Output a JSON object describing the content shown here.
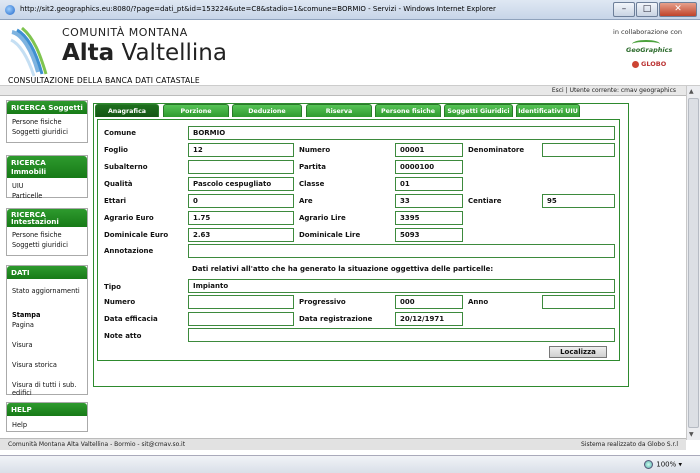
{
  "browser": {
    "title": "http://sit2.geographics.eu:8080/?page=dati_pt&id=153224&ute=C8&stadio=1&comune=BORMIO - Servizi - Windows Internet Explorer",
    "zoom": "100%"
  },
  "header": {
    "org_top": "COMUNITÀ MONTANA",
    "org_main_bold": "Alta",
    "org_main_rest": "Valtellina",
    "subtitle": "CONSULTAZIONE DELLA BANCA DATI CATASTALE",
    "collab": "in collaborazione con",
    "geo_logo": "GeoGraphics",
    "globo_logo": "GLOBO"
  },
  "userbar": {
    "text": "Esci | Utente corrente: cmav geographics"
  },
  "sidebar": {
    "soggetti": {
      "title": "RICERCA Soggetti",
      "items": [
        "Persone fisiche",
        "Soggetti giuridici"
      ]
    },
    "immobili": {
      "title": "RICERCA Immobili",
      "items": [
        "UIU",
        "Particelle"
      ]
    },
    "intestazioni": {
      "title": "RICERCA Intestazioni",
      "items": [
        "Persone fisiche",
        "Soggetti giuridici"
      ]
    },
    "dati": {
      "title": "DATI",
      "stato": "Stato aggiornamenti",
      "stampa": "Stampa",
      "items": [
        "Pagina",
        "Visura",
        "Visura storica",
        "Visura di tutti i sub. edifici"
      ]
    },
    "help": {
      "title": "HELP",
      "items": [
        "Help"
      ]
    }
  },
  "tabs": [
    "Anagrafica",
    "Porzione",
    "Deduzione",
    "Riserva",
    "Persone fisiche",
    "Soggetti Giuridici",
    "Identificativi UIU"
  ],
  "form": {
    "comune_label": "Comune",
    "comune": "BORMIO",
    "foglio_label": "Foglio",
    "foglio": "12",
    "numero_label": "Numero",
    "numero": "00001",
    "denominatore_label": "Denominatore",
    "denominatore": "",
    "subalterno_label": "Subalterno",
    "subalterno": "",
    "partita_label": "Partita",
    "partita": "0000100",
    "qualita_label": "Qualità",
    "qualita": "Pascolo cespugliato",
    "classe_label": "Classe",
    "classe": "01",
    "ettari_label": "Ettari",
    "ettari": "0",
    "are_label": "Are",
    "are": "33",
    "centiare_label": "Centiare",
    "centiare": "95",
    "agrario_euro_label": "Agrario Euro",
    "agrario_euro": "1.75",
    "agrario_lire_label": "Agrario Lire",
    "agrario_lire": "3395",
    "dominicale_euro_label": "Dominicale Euro",
    "dominicale_euro": "2.63",
    "dominicale_lire_label": "Dominicale Lire",
    "dominicale_lire": "5093",
    "annotazione_label": "Annotazione",
    "annotazione": "",
    "info": "Dati relativi all'atto che ha generato la situazione oggettiva delle particelle:",
    "tipo_label": "Tipo",
    "tipo": "Impianto",
    "numero2_label": "Numero",
    "numero2": "",
    "progressivo_label": "Progressivo",
    "progressivo": "000",
    "anno_label": "Anno",
    "anno": "",
    "data_efficacia_label": "Data efficacia",
    "data_efficacia": "",
    "data_registrazione_label": "Data registrazione",
    "data_registrazione": "20/12/1971",
    "note_atto_label": "Note atto",
    "note_atto": "",
    "localizza": "Localizza"
  },
  "footer": {
    "left": "Comunità Montana Alta Valtellina - Bormio - sit@cmav.so.it",
    "right": "Sistema realizzato da Globo S.r.l"
  }
}
